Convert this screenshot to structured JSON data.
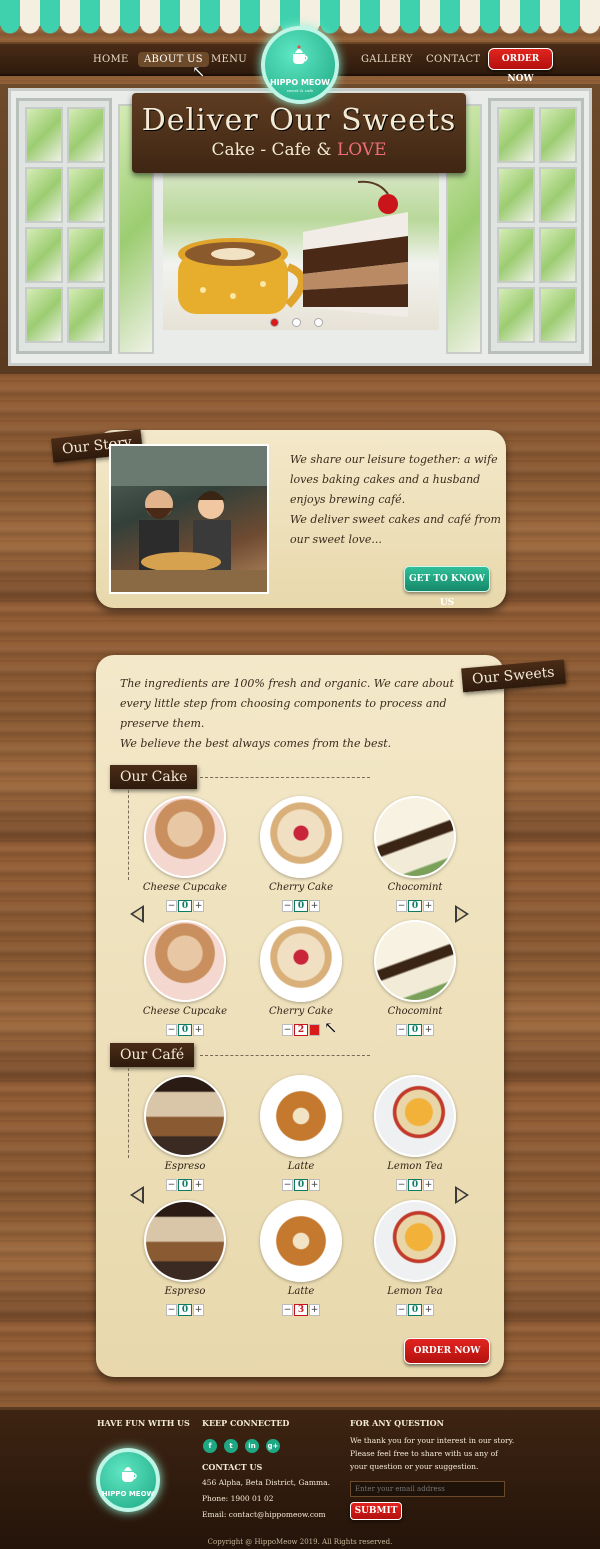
{
  "nav": {
    "items": [
      "HOME",
      "ABOUT US",
      "MENU",
      "GALLERY",
      "CONTACT"
    ],
    "order_label": "ORDER NOW"
  },
  "logo": {
    "name": "HIPPO MEOW",
    "tagline": "sweet & cafe"
  },
  "hero": {
    "title": "Deliver Our Sweets",
    "subtitle_prefix": "Cake - Cafe & ",
    "subtitle_love": "LOVE",
    "slide_count": 3,
    "active_slide": 1
  },
  "story": {
    "tag": "Our Story",
    "text_line1": "We share our leisure together: a wife",
    "text_line2": "loves baking cakes and a husband",
    "text_line3": "enjoys brewing café.",
    "text_line4": "We deliver sweet cakes and café from",
    "text_line5": "our sweet love...",
    "button": "GET TO KNOW US"
  },
  "sweets": {
    "tag": "Our Sweets",
    "intro_line1": "The ingredients are 100% fresh and organic. We care about",
    "intro_line2": "every little step from choosing components to process and",
    "intro_line3": "preserve them.",
    "intro_line4": "We believe the best always comes from the best.",
    "cake_tag": "Our Cake",
    "cafe_tag": "Our Café",
    "cakes": [
      {
        "name": "Cheese Cupcake",
        "qty": "0"
      },
      {
        "name": "Cherry Cake",
        "qty": "0"
      },
      {
        "name": "Chocomint",
        "qty": "0"
      },
      {
        "name": "Cheese Cupcake",
        "qty": "0"
      },
      {
        "name": "Cherry Cake",
        "qty": "2"
      },
      {
        "name": "Chocomint",
        "qty": "0"
      }
    ],
    "cafes": [
      {
        "name": "Espreso",
        "qty": "0"
      },
      {
        "name": "Latte",
        "qty": "0"
      },
      {
        "name": "Lemon Tea",
        "qty": "0"
      },
      {
        "name": "Espreso",
        "qty": "0"
      },
      {
        "name": "Latte",
        "qty": "3"
      },
      {
        "name": "Lemon Tea",
        "qty": "0"
      }
    ],
    "minus": "−",
    "plus": "+",
    "order_button": "ORDER NOW"
  },
  "footer": {
    "fun_head": "HAVE FUN WITH US",
    "connect_head": "KEEP CONNECTED",
    "social": [
      "f",
      "t",
      "in",
      "g+"
    ],
    "contact_head": "CONTACT US",
    "address": "456 Alpha, Beta District, Gamma.",
    "phone": "Phone: 1900 01 02",
    "email": "Email: contact@hippomeow.com",
    "question_head": "FOR ANY QUESTION",
    "question_line1": "We thank you for your interest in our story.",
    "question_line2": "Please feel free to share with us any of",
    "question_line3": "your question or your suggestion.",
    "email_placeholder": "Enter your email address",
    "submit": "SUBMIT",
    "copyright": "Copyright @ HippoMeow 2019. All Rights reserved."
  },
  "colors": {
    "teal": "#1ea783",
    "red": "#d81b1b",
    "wood": "#8a5a33",
    "paper": "#f3e8c9"
  }
}
